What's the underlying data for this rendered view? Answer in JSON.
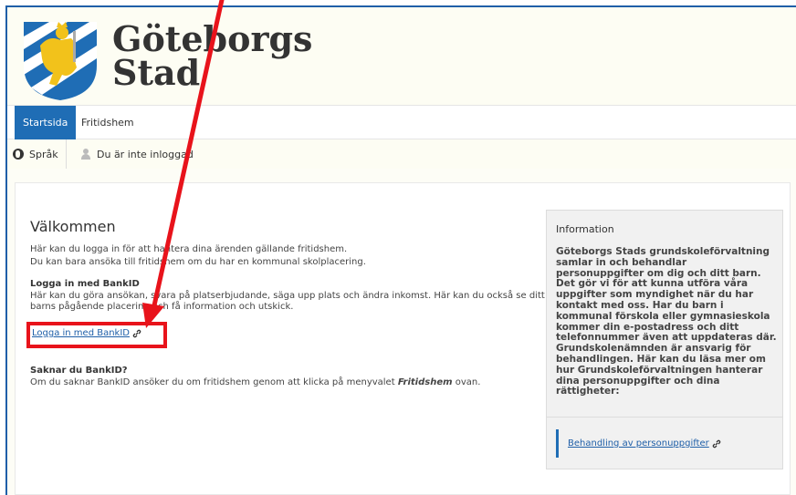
{
  "logo": {
    "line1": "Göteborgs",
    "line2": "Stad"
  },
  "nav": {
    "tabs": [
      {
        "label": "Startsida"
      },
      {
        "label": "Fritidshem"
      }
    ]
  },
  "subbar": {
    "language": "Språk",
    "user_status": "Du är inte inloggad"
  },
  "main": {
    "title": "Välkommen",
    "intro_line1": "Här kan du logga in för att hantera dina ärenden gällande fritidshem.",
    "intro_line2": "Du kan bara ansöka till fritidshem om du har en kommunal skolplacering.",
    "bankid_heading": "Logga in med BankID",
    "bankid_desc": "Här kan du göra ansökan, svara på platserbjudande, säga upp plats och ändra inkomst. Här kan du också se ditt barns pågående placering och få information och utskick.",
    "bankid_link": "Logga in med BankID",
    "nobank_heading": "Saknar du BankID?",
    "nobank_desc_pre": "Om du saknar BankID ansöker du om fritidshem genom att klicka på menyvalet ",
    "nobank_desc_em": "Fritidshem",
    "nobank_desc_post": " ovan."
  },
  "info": {
    "heading": "Information",
    "text": "Göteborgs Stads grundskoleförvaltning samlar in och behandlar personuppgifter om dig och ditt barn. Det gör vi för att kunna utföra våra uppgifter som myndighet när du har kontakt med oss. Har du barn i kommunal förskola eller gymnasieskola kommer din e-postadress och ditt telefonnummer även att uppdateras där. Grundskolenämnden är ansvarig för behandlingen. Här kan du läsa mer om hur Grundskoleförvaltningen hanterar dina personuppgifter och dina rättigheter:",
    "link": "Behandling av personuppgifter"
  },
  "colors": {
    "accent": "#1f6db5",
    "annotation": "#e8131b"
  }
}
